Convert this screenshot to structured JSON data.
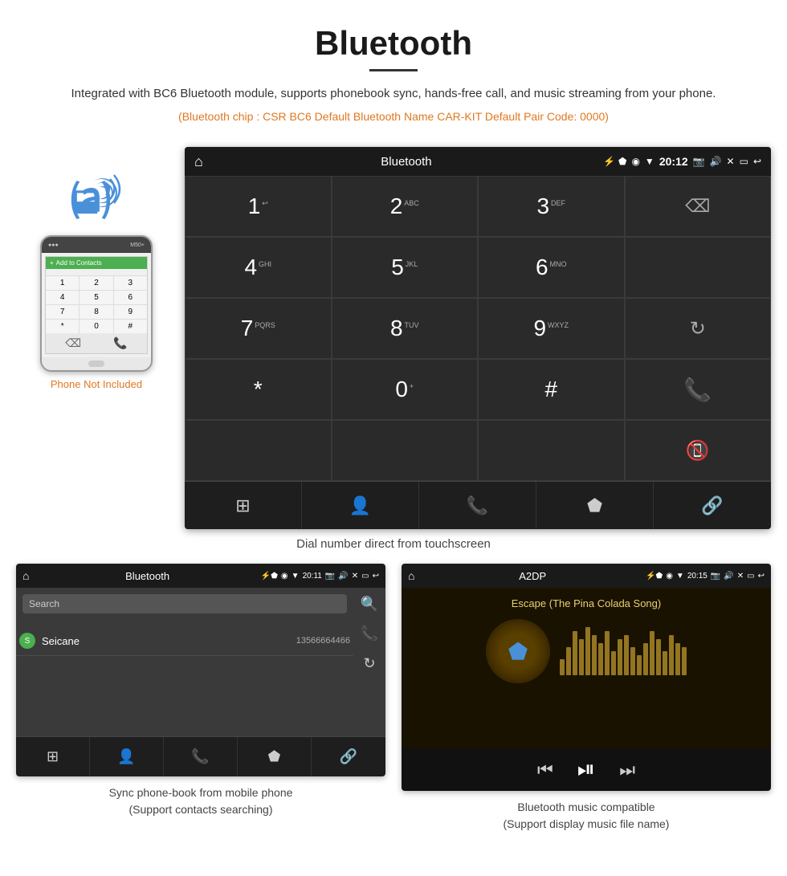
{
  "header": {
    "title": "Bluetooth",
    "description": "Integrated with BC6 Bluetooth module, supports phonebook sync, hands-free call, and music streaming from your phone.",
    "specs": "(Bluetooth chip : CSR BC6    Default Bluetooth Name CAR-KIT    Default Pair Code: 0000)"
  },
  "dialer_screen": {
    "status_bar": {
      "app_name": "Bluetooth",
      "time": "20:12"
    },
    "keys": [
      {
        "num": "1",
        "sub": "↩"
      },
      {
        "num": "2",
        "sub": "ABC"
      },
      {
        "num": "3",
        "sub": "DEF"
      },
      {
        "num": "4",
        "sub": "GHI"
      },
      {
        "num": "5",
        "sub": "JKL"
      },
      {
        "num": "6",
        "sub": "MNO"
      },
      {
        "num": "7",
        "sub": "PQRS"
      },
      {
        "num": "8",
        "sub": "TUV"
      },
      {
        "num": "9",
        "sub": "WXYZ"
      },
      {
        "num": "*",
        "sub": ""
      },
      {
        "num": "0",
        "sub": "+"
      },
      {
        "num": "#",
        "sub": ""
      }
    ],
    "subtitle": "Dial number direct from touchscreen"
  },
  "phonebook_screen": {
    "status_bar": {
      "app_name": "Bluetooth",
      "time": "20:11"
    },
    "search_placeholder": "Search",
    "contacts": [
      {
        "letter": "S",
        "name": "Seicane",
        "number": "13566664466"
      }
    ],
    "caption": "Sync phone-book from mobile phone\n(Support contacts searching)"
  },
  "music_screen": {
    "status_bar": {
      "app_name": "A2DP",
      "time": "20:15"
    },
    "song_title": "Escape (The Pina Colada Song)",
    "caption": "Bluetooth music compatible\n(Support display music file name)"
  },
  "phone_mockup": {
    "not_included": "Phone Not Included"
  },
  "waveform_bars": [
    20,
    35,
    55,
    45,
    60,
    50,
    40,
    55,
    30,
    45,
    50,
    35,
    25,
    40,
    55,
    45,
    30,
    50,
    40,
    35
  ]
}
